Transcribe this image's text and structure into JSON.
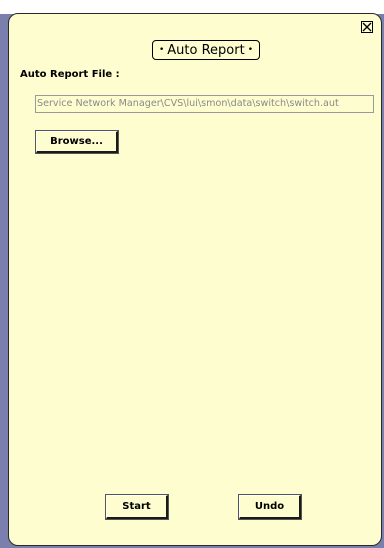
{
  "dialog": {
    "title": "Auto Report"
  },
  "file": {
    "label": "Auto Report File :",
    "path": "Service Network Manager\\CVS\\lui\\smon\\data\\switch\\switch.aut"
  },
  "buttons": {
    "browse": "Browse...",
    "start": "Start",
    "undo": "Undo"
  },
  "colors": {
    "panel_bg": "#fdfdd0",
    "desktop_bg": "#7b7fad"
  },
  "icons": {
    "close": "close-icon"
  }
}
